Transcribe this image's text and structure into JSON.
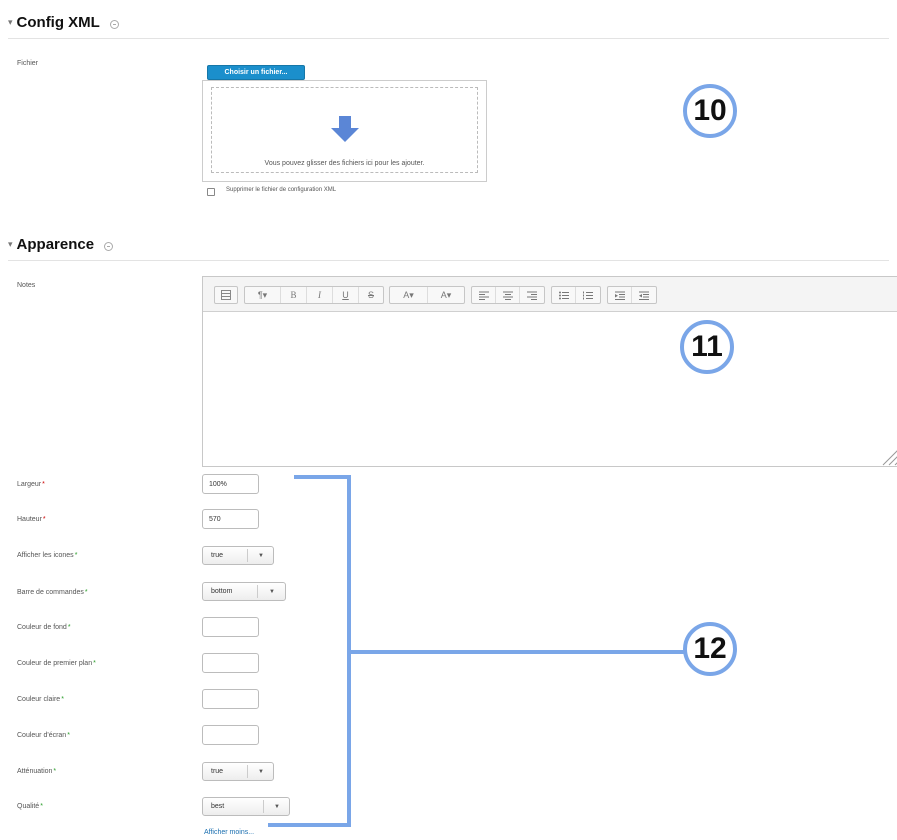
{
  "config_section": {
    "title": "Config XML",
    "file_label": "Fichier",
    "choose_button": "Choisir un fichier...",
    "drop_text": "Vous pouvez glisser des fichiers ici pour les ajouter.",
    "delete_checkbox_label": "Supprimer le fichier de configuration XML",
    "delete_checked": false
  },
  "appearance_section": {
    "title": "Apparence",
    "notes_label": "Notes",
    "toolbar_groups": [
      [
        "table-icon"
      ],
      [
        "paragraph-style-icon",
        "bold-icon",
        "italic-icon",
        "underline-icon",
        "strikethrough-icon"
      ],
      [
        "text-color-icon",
        "background-color-icon"
      ],
      [
        "align-left-icon",
        "align-center-icon",
        "align-right-icon"
      ],
      [
        "bullet-list-icon",
        "numbered-list-icon"
      ],
      [
        "outdent-icon",
        "indent-icon"
      ]
    ],
    "toolbar_glyphs": {
      "paragraph": "¶▾",
      "bold": "B",
      "italic": "I",
      "underline": "U",
      "strike": "S",
      "text_color": "A▾",
      "bg_color": "A▾"
    }
  },
  "fields": {
    "width": {
      "label": "Largeur",
      "value": "100%"
    },
    "height": {
      "label": "Hauteur",
      "value": "570"
    },
    "show_icons": {
      "label": "Afficher les icones",
      "value": "true"
    },
    "command_bar": {
      "label": "Barre de commandes",
      "value": "bottom"
    },
    "bg_color": {
      "label": "Couleur de fond",
      "value": ""
    },
    "fg_color": {
      "label": "Couleur de premier plan",
      "value": ""
    },
    "light_color": {
      "label": "Couleur claire",
      "value": ""
    },
    "screen_color": {
      "label": "Couleur d'écran",
      "value": ""
    },
    "attenuation": {
      "label": "Atténuation",
      "value": "true"
    },
    "quality": {
      "label": "Qualité",
      "value": "best"
    }
  },
  "show_less_link": "Afficher moins...",
  "callouts": {
    "c10": "10",
    "c11": "11",
    "c12": "12"
  },
  "colors": {
    "accent": "#1b8fcc",
    "callout": "#7aa6e8",
    "required": "#cc0000",
    "optional": "#2a9d2a"
  }
}
